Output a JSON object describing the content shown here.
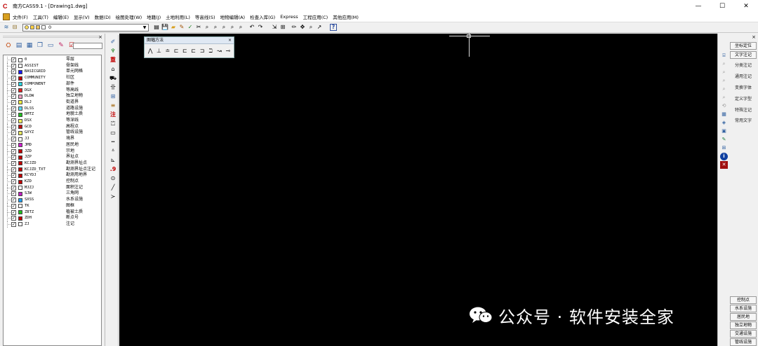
{
  "window": {
    "title": "南方CASS9.1 - [Drawing1.dwg]",
    "logo_glyph": "C",
    "controls": [
      "—",
      "☐",
      "✕"
    ]
  },
  "menu": [
    "文件(F)",
    "工具(T)",
    "编辑(E)",
    "显示(V)",
    "数据(D)",
    "绘图处理(W)",
    "地籍(J)",
    "土地利用(L)",
    "等高线(S)",
    "地物编辑(A)",
    "检查入库(G)",
    "Express",
    "工程应用(C)",
    "其他应用(M)"
  ],
  "toolbar": {
    "layer_value": "0",
    "icons": [
      "▤",
      "💾",
      "✎",
      "✓",
      "✂",
      "⌕",
      "⌕",
      "⌕",
      "⌕",
      "⌕",
      "↶",
      "↷",
      "⇲",
      "⊞",
      "✏",
      "✥",
      "⌕",
      "↗",
      "?"
    ]
  },
  "layers": [
    {
      "name": "0",
      "desc": "零层",
      "color": "#ffffff"
    },
    {
      "name": "ASSIST",
      "desc": "骨架线",
      "color": "#ffffff"
    },
    {
      "name": "BASICGRID",
      "desc": "单元网格",
      "color": "#1a1aff"
    },
    {
      "name": "COMMUNITY",
      "desc": "社区",
      "color": "#c00000"
    },
    {
      "name": "COMPONENT",
      "desc": "部件",
      "color": "#29d4e0"
    },
    {
      "name": "DGX",
      "desc": "等高线",
      "color": "#e02020"
    },
    {
      "name": "DLDW",
      "desc": "独立地物",
      "color": "#f0a0c0"
    },
    {
      "name": "DLJ",
      "desc": "街道界",
      "color": "#f0f040"
    },
    {
      "name": "DLSS",
      "desc": "道路设施",
      "color": "#60d8f0"
    },
    {
      "name": "DMTZ",
      "desc": "地貌土质",
      "color": "#20c020"
    },
    {
      "name": "DSX",
      "desc": "等深线",
      "color": "#f0f060"
    },
    {
      "name": "GCD",
      "desc": "高程点",
      "color": "#c01010"
    },
    {
      "name": "GXYZ",
      "desc": "管线设施",
      "color": "#e8e860"
    },
    {
      "name": "JJ",
      "desc": "境界",
      "color": "#ffffff"
    },
    {
      "name": "JMD",
      "desc": "居民地",
      "color": "#d020d0"
    },
    {
      "name": "JZD",
      "desc": "宗地",
      "color": "#c00000"
    },
    {
      "name": "JZP",
      "desc": "界址点",
      "color": "#c00000"
    },
    {
      "name": "KCJZD",
      "desc": "勘测界址点",
      "color": "#c00000"
    },
    {
      "name": "KCJZD_TXT",
      "desc": "勘测界址点注记",
      "color": "#c00000"
    },
    {
      "name": "KCYDJ",
      "desc": "勘测用地界",
      "color": "#c00000"
    },
    {
      "name": "KZD",
      "desc": "控制点",
      "color": "#c00000"
    },
    {
      "name": "MJZJ",
      "desc": "面积注记",
      "color": "#ffffff"
    },
    {
      "name": "SJW",
      "desc": "三角网",
      "color": "#c020c0"
    },
    {
      "name": "SXSS",
      "desc": "水系设施",
      "color": "#20a0f0"
    },
    {
      "name": "TK",
      "desc": "图框",
      "color": "#ffffff"
    },
    {
      "name": "ZBTZ",
      "desc": "植被土质",
      "color": "#20c020"
    },
    {
      "name": "ZDH",
      "desc": "断点号",
      "color": "#c00000"
    },
    {
      "name": "ZJ",
      "desc": "注记",
      "color": "#ffffff"
    }
  ],
  "float_panel": {
    "title": "图幅方法",
    "close": "×",
    "tools": [
      "⋀",
      "⊥",
      "≐",
      "⊏",
      "⊏",
      "⊏",
      "⊐",
      "ℶ",
      "↝",
      "⊸"
    ]
  },
  "right_panel": {
    "close": "×",
    "top_buttons": [
      "坐标定位",
      "文字注记"
    ],
    "menu_items": [
      "分类注记",
      "通用注记",
      "变换字体",
      "定义字型",
      "特殊注记",
      "常用文字"
    ],
    "bottom_buttons": [
      "控制点",
      "水系设施",
      "居民地",
      "独立地物",
      "交通设施",
      "管线设施"
    ]
  },
  "watermark": {
    "text": "公众号 · 软件安装全家"
  }
}
